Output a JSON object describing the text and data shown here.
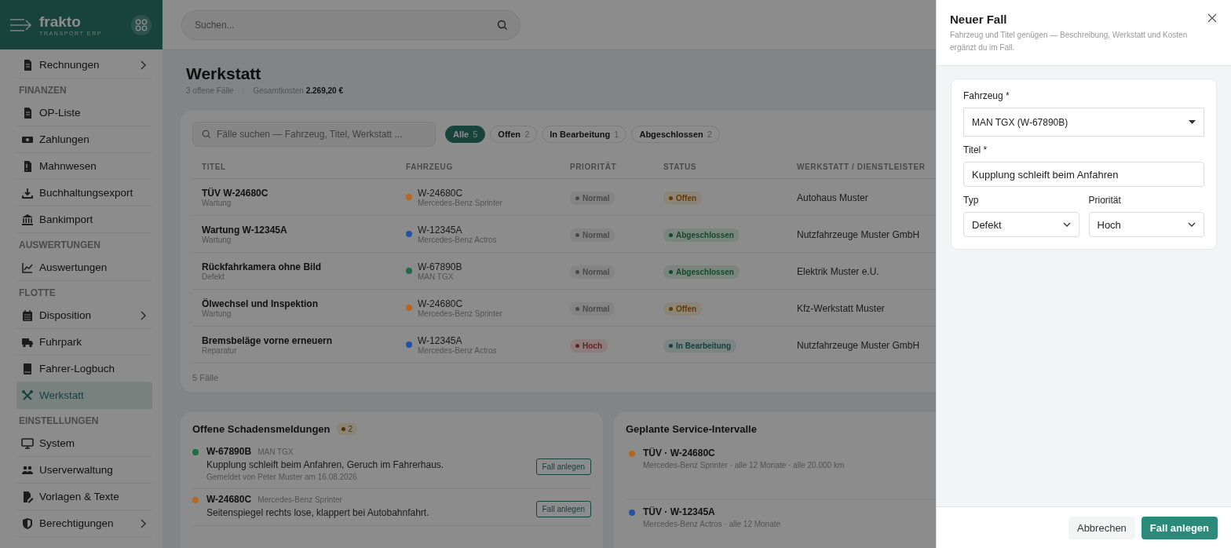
{
  "brand": {
    "name": "frakto",
    "tagline": "TRANSPORT ERP"
  },
  "search": {
    "placeholder": "Suchen..."
  },
  "sidebar": {
    "items": [
      {
        "kind": "item",
        "label": "Rechnungen",
        "chevron": true,
        "selected": false
      },
      {
        "kind": "section",
        "label": "FINANZEN"
      },
      {
        "kind": "item",
        "label": "OP-Liste",
        "chevron": false,
        "selected": false
      },
      {
        "kind": "item",
        "label": "Zahlungen",
        "chevron": false,
        "selected": false
      },
      {
        "kind": "item",
        "label": "Mahnwesen",
        "chevron": false,
        "selected": false
      },
      {
        "kind": "item",
        "label": "Buchhaltungsexport",
        "chevron": false,
        "selected": false
      },
      {
        "kind": "item",
        "label": "Bankimport",
        "chevron": false,
        "selected": false
      },
      {
        "kind": "section",
        "label": "AUSWERTUNGEN"
      },
      {
        "kind": "item",
        "label": "Auswertungen",
        "chevron": false,
        "selected": false
      },
      {
        "kind": "section",
        "label": "FLOTTE"
      },
      {
        "kind": "item",
        "label": "Disposition",
        "chevron": true,
        "selected": false
      },
      {
        "kind": "item",
        "label": "Fuhrpark",
        "chevron": false,
        "selected": false
      },
      {
        "kind": "item",
        "label": "Fahrer-Logbuch",
        "chevron": false,
        "selected": false
      },
      {
        "kind": "item",
        "label": "Werkstatt",
        "chevron": false,
        "selected": true
      },
      {
        "kind": "section",
        "label": "EINSTELLUNGEN"
      },
      {
        "kind": "item",
        "label": "System",
        "chevron": false,
        "selected": false
      },
      {
        "kind": "item",
        "label": "Userverwaltung",
        "chevron": false,
        "selected": false
      },
      {
        "kind": "item",
        "label": "Vorlagen & Texte",
        "chevron": false,
        "selected": false
      },
      {
        "kind": "item",
        "label": "Berechtigungen",
        "chevron": true,
        "selected": false
      }
    ]
  },
  "page": {
    "title": "Werkstatt",
    "summary": "3 offene Fälle",
    "total": "Gesamtkosten **2.269,20 €**"
  },
  "cases": {
    "search_placeholder": "Fälle suchen — Fahrzeug, Titel, Werkstatt ...",
    "filters": [
      {
        "label": "Alle",
        "count": "5",
        "selected": true
      },
      {
        "label": "Offen",
        "count": "2",
        "selected": false
      },
      {
        "label": "In Bearbeitung",
        "count": "1",
        "selected": false
      },
      {
        "label": "Abgeschlossen",
        "count": "2",
        "selected": false
      }
    ],
    "columns": [
      "TITEL",
      "FAHRZEUG",
      "PRIORITÄT",
      "STATUS",
      "WERKSTATT / DIENSTLEISTER"
    ],
    "rows": [
      {
        "title": "TÜV W-24680C",
        "type": "Wartung",
        "plate": "W-24680C",
        "color": "#b8661e",
        "model": "Mercedes-Benz Sprinter",
        "priority": {
          "kind": "normal",
          "label": "Normal"
        },
        "status": {
          "kind": "open",
          "label": "Offen"
        },
        "workshop": "Autohaus Muster"
      },
      {
        "title": "Wartung W-12345A",
        "type": "Wartung",
        "plate": "W-12345A",
        "color": "#2452a8",
        "model": "Mercedes-Benz Actros",
        "priority": {
          "kind": "normal",
          "label": "Normal"
        },
        "status": {
          "kind": "done",
          "label": "Abgeschlossen"
        },
        "workshop": "Nutzfahrzeuge Muster GmbH"
      },
      {
        "title": "Rückfahrkamera ohne Bild",
        "type": "Defekt",
        "plate": "W-67890B",
        "color": "#1e6b45",
        "model": "MAN TGX",
        "priority": {
          "kind": "normal",
          "label": "Normal"
        },
        "status": {
          "kind": "done",
          "label": "Abgeschlossen"
        },
        "workshop": "Elektrik Muster e.U."
      },
      {
        "title": "Ölwechsel und Inspektion",
        "type": "Wartung",
        "plate": "W-24680C",
        "color": "#b8661e",
        "model": "Mercedes-Benz Sprinter",
        "priority": {
          "kind": "normal",
          "label": "Normal"
        },
        "status": {
          "kind": "open",
          "label": "Offen"
        },
        "workshop": "Kfz-Werkstatt Muster"
      },
      {
        "title": "Bremsbeläge vorne erneuern",
        "type": "Reparatur",
        "plate": "W-12345A",
        "color": "#2452a8",
        "model": "Mercedes-Benz Actros",
        "priority": {
          "kind": "high",
          "label": "Hoch"
        },
        "status": {
          "kind": "progress",
          "label": "In Bearbeitung"
        },
        "workshop": "Nutzfahrzeuge Muster GmbH"
      }
    ],
    "footer": "5 Fälle"
  },
  "damage_reports": {
    "title": "Offene Schadensmeldungen",
    "count": "2",
    "items": [
      {
        "plate": "W-67890B",
        "color": "#1e6b45",
        "model": "MAN TGX",
        "text": "Kupplung schleift beim Anfahren, Geruch im Fahrerhaus.",
        "meta": "Gemeldet von Peter Muster am 16.08.2026",
        "action": "Fall anlegen"
      },
      {
        "plate": "W-24680C",
        "color": "#b8661e",
        "model": "Mercedes-Benz Sprinter",
        "text": "Seitenspiegel rechts lose, klappert bei Autobahnfahrt.",
        "action": "Fall anlegen"
      }
    ]
  },
  "service_intervals": {
    "title": "Geplante Service-Intervalle",
    "items": [
      {
        "title": "TÜV · W-24680C",
        "color": "#b8661e",
        "detail": "Mercedes-Benz Sprinter · alle 12 Monate · alle 20.000 km"
      },
      {
        "title": "TÜV · W-12345A",
        "color": "#2452a8",
        "detail": "Mercedes-Benz Actros · alle 12 Monate"
      }
    ]
  },
  "drawer": {
    "title": "Neuer Fall",
    "subtitle": "Fahrzeug und Titel genügen — Beschreibung, Werkstatt und Kosten ergänzt du im Fall.",
    "fields": [
      {
        "kind": "native-select",
        "label": "Fahrzeug *",
        "value": "MAN TGX (W-67890B)"
      },
      {
        "kind": "text",
        "label": "Titel *",
        "value": "Kupplung schleift beim Anfahren"
      },
      {
        "kind": "select",
        "label": "Typ",
        "value": "Defekt"
      },
      {
        "kind": "select",
        "label": "Priorität",
        "value": "Hoch"
      }
    ],
    "buttons": [
      {
        "kind": "secondary",
        "label": "Abbrechen"
      },
      {
        "kind": "primary",
        "label": "Fall anlegen"
      }
    ]
  }
}
